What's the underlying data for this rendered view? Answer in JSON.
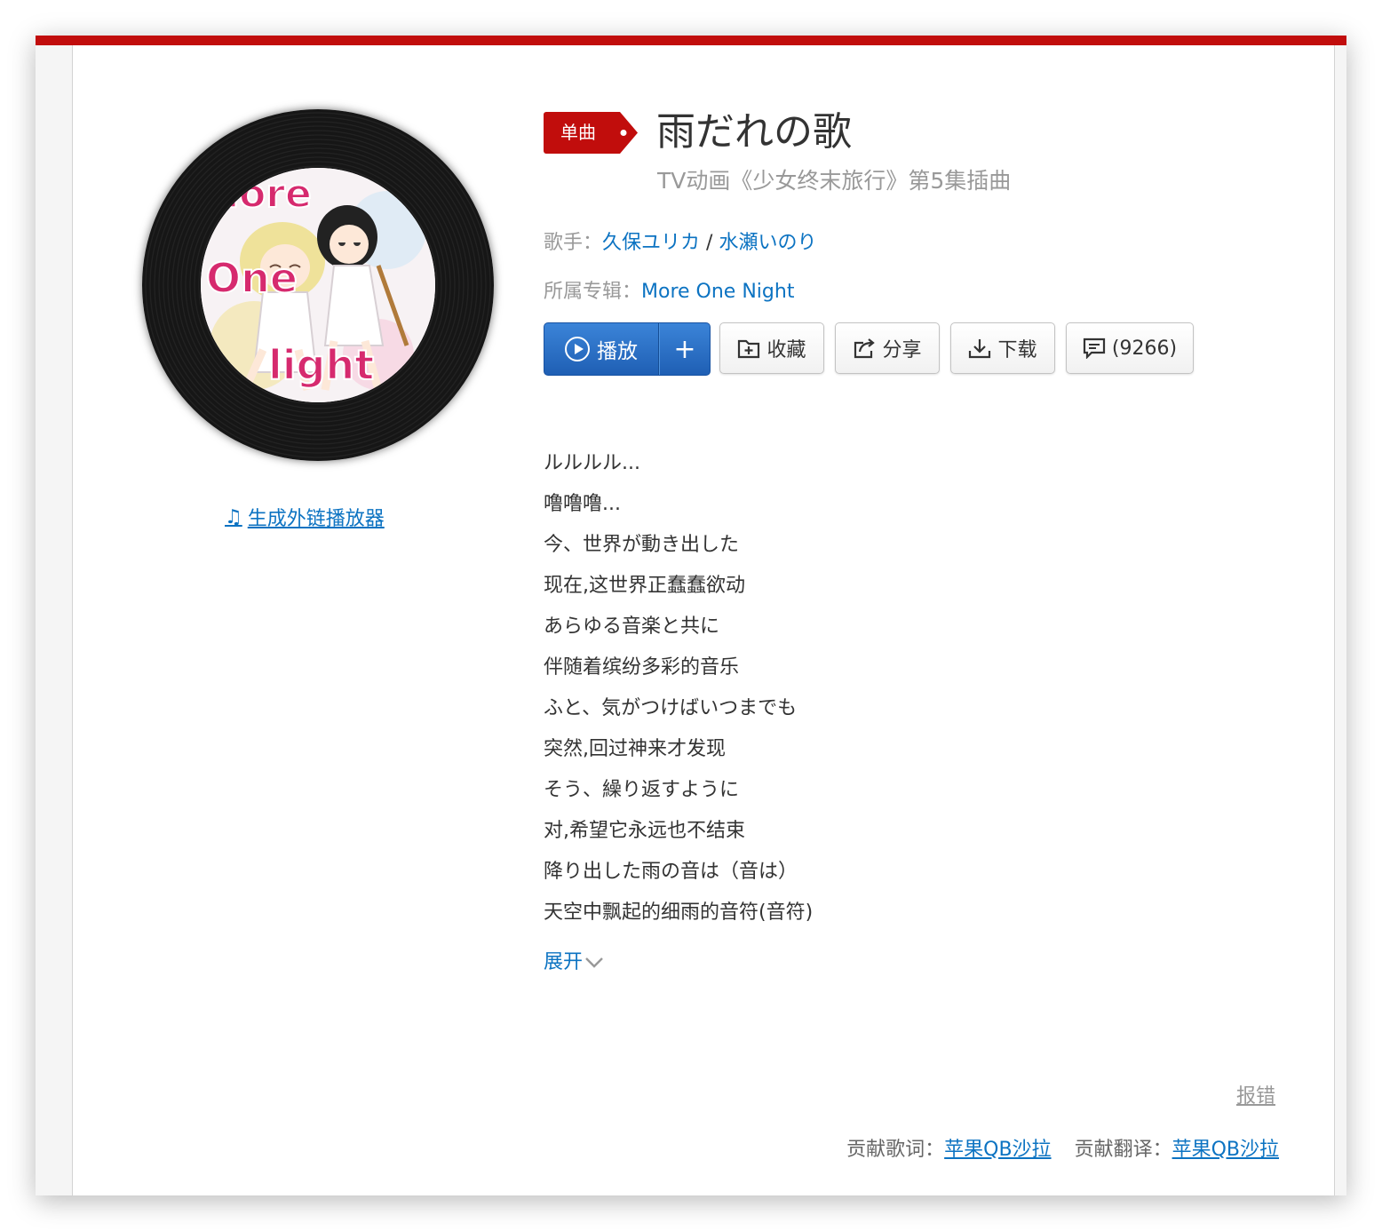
{
  "song": {
    "type_badge": "单曲",
    "title": "雨だれの歌",
    "subtitle": "TV动画《少女终末旅行》第5集插曲",
    "artist_label": "歌手：",
    "artists": [
      "久保ユリカ",
      "水瀬いのり"
    ],
    "artist_separator": " / ",
    "album_label": "所属专辑：",
    "album": "More One Night"
  },
  "cover": {
    "art_text": [
      "lore",
      "One",
      "light"
    ]
  },
  "external_player_link": "生成外链播放器",
  "toolbar": {
    "play_label": "播放",
    "add_label": "+",
    "collect_label": "收藏",
    "share_label": "分享",
    "download_label": "下载",
    "comment_label": "(9266)"
  },
  "lyrics": [
    "ルルルル...",
    "噜噜噜...",
    "今、世界が動き出した",
    "现在,这世界正蠢蠢欲动",
    "あらゆる音楽と共に",
    "伴随着缤纷多彩的音乐",
    "ふと、気がつけばいつまでも",
    "突然,回过神来才发现",
    "そう、繰り返すように",
    "对,希望它永远也不结束",
    "降り出した雨の音は（音は）",
    "天空中飘起的细雨的音符(音符)"
  ],
  "expand_label": "展开",
  "report_label": "报错",
  "contributors": {
    "lyrics_label": "贡献歌词：",
    "lyrics_user": "苹果QB沙拉",
    "translation_label": "贡献翻译：",
    "translation_user": "苹果QB沙拉"
  },
  "colors": {
    "brand_red": "#c10d0c",
    "link_blue": "#0c73c2",
    "play_blue": "#2b6fc4"
  }
}
